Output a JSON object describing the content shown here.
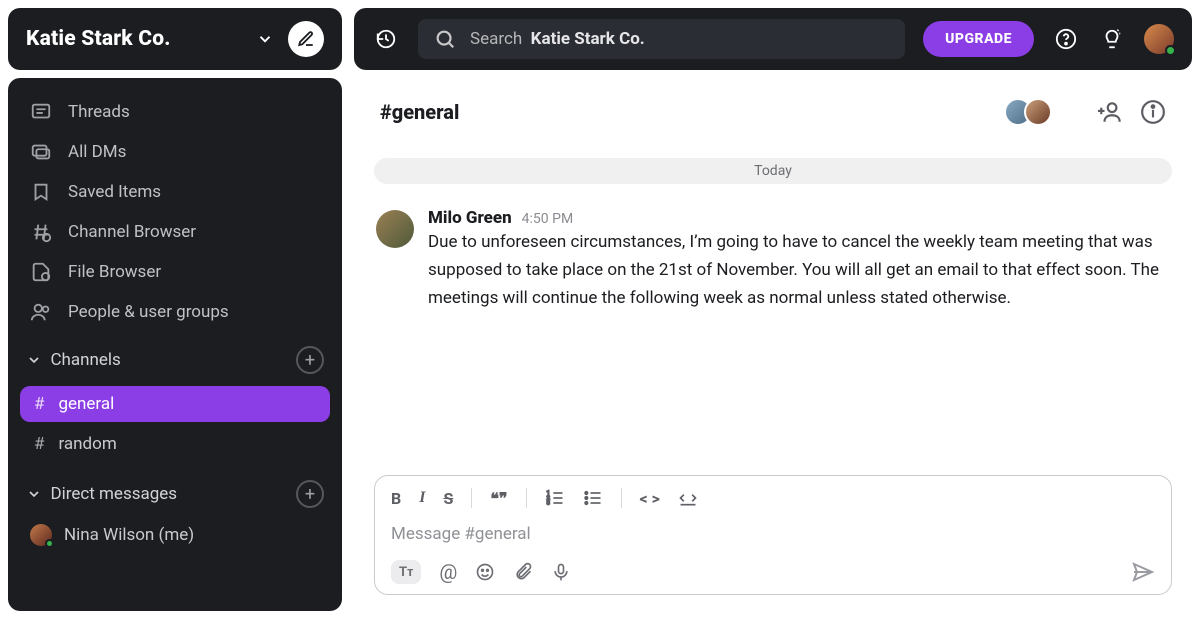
{
  "workspace": {
    "name": "Katie Stark Co."
  },
  "search": {
    "placeholder_prefix": "Search",
    "placeholder_context": "Katie Stark Co."
  },
  "upgrade_label": "UPGRADE",
  "sidebar": {
    "nav": {
      "threads": "Threads",
      "dms": "All DMs",
      "saved": "Saved Items",
      "channel_browser": "Channel Browser",
      "file_browser": "File Browser",
      "people": "People & user groups"
    },
    "channels_label": "Channels",
    "channels": [
      {
        "name": "general",
        "active": true
      },
      {
        "name": "random",
        "active": false
      }
    ],
    "dms_label": "Direct messages",
    "dms": [
      {
        "name": "Nina Wilson (me)"
      }
    ]
  },
  "channel_header": {
    "title": "#general"
  },
  "day_divider": "Today",
  "messages": [
    {
      "author": "Milo Green",
      "time": "4:50 PM",
      "body": "Due to unforeseen circumstances, I’m going to have to cancel the weekly team meeting that was supposed to take place on the 21st of November. You will all get an email to that effect soon. The meetings will continue the following week as normal unless stated otherwise."
    }
  ],
  "composer": {
    "placeholder": "Message #general"
  }
}
